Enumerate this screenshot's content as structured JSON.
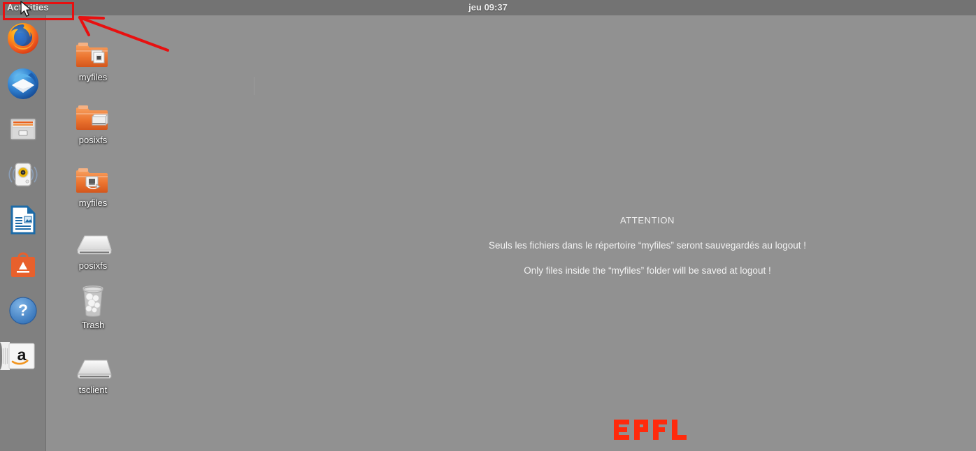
{
  "topbar": {
    "activities_label": "Activities",
    "clock": "jeu 09:37"
  },
  "dock": {
    "items": [
      {
        "name": "firefox",
        "label": "Firefox Web Browser"
      },
      {
        "name": "thunderbird",
        "label": "Thunderbird Mail"
      },
      {
        "name": "files",
        "label": "Files"
      },
      {
        "name": "rhythmbox",
        "label": "Rhythmbox"
      },
      {
        "name": "libreoffice-writer",
        "label": "LibreOffice Writer"
      },
      {
        "name": "ubuntu-software",
        "label": "Ubuntu Software"
      },
      {
        "name": "help",
        "label": "Help"
      },
      {
        "name": "amazon",
        "label": "Amazon"
      }
    ]
  },
  "desktop": {
    "icons": [
      {
        "label": "myfiles",
        "type": "folder-with-files-badge"
      },
      {
        "label": "posixfs",
        "type": "folder-with-drive-badge"
      },
      {
        "label": "myfiles",
        "type": "folder-network-share"
      },
      {
        "label": "posixfs",
        "type": "drive"
      },
      {
        "label": "Trash",
        "type": "trash-full"
      },
      {
        "label": "tsclient",
        "type": "drive"
      }
    ]
  },
  "notice": {
    "title": "ATTENTION",
    "line_fr": "Seuls les fichiers dans le répertoire “myfiles” seront sauvegardés au logout !",
    "line_en": "Only files inside the “myfiles” folder will be saved at logout !"
  },
  "branding": {
    "logo_text": "EPFL",
    "logo_color": "#ff2a0c"
  },
  "annotation": {
    "highlight_color": "#e81010",
    "target": "Activities"
  },
  "colors": {
    "topbar": "#737373",
    "dock": "#808080",
    "desktop": "#919191",
    "folder_orange": "#e8672b",
    "label_text": "#ffffff"
  }
}
